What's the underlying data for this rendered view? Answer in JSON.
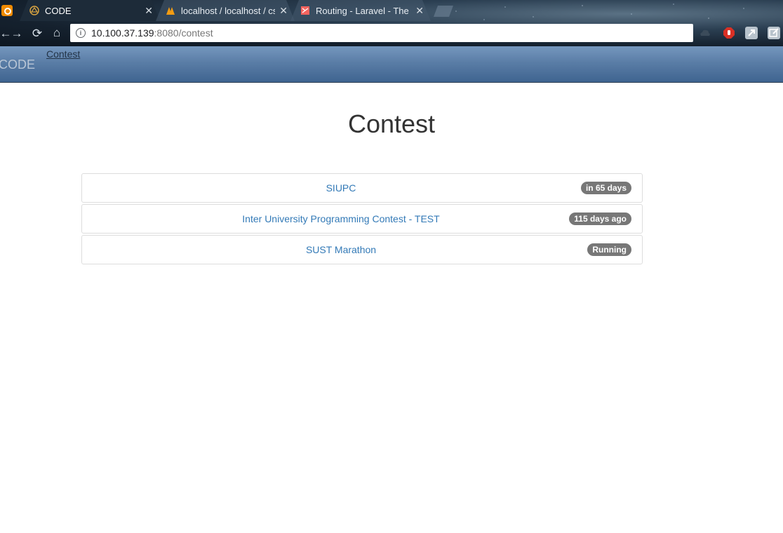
{
  "browser": {
    "tabs": [
      {
        "title": "CODE",
        "active": true
      },
      {
        "title": "localhost / localhost / cs",
        "active": false
      },
      {
        "title": "Routing - Laravel - The f",
        "active": false
      }
    ],
    "url_host": "10.100.37.139",
    "url_rest": ":8080/contest",
    "colors": {
      "frame": "#15212e",
      "omnibox": "#ffffff"
    }
  },
  "navbar": {
    "brand": "CODE",
    "links": [
      "Contest"
    ],
    "colors": {
      "gradient_top": "#7597be",
      "gradient_bottom": "#3f6490"
    }
  },
  "main": {
    "title": "Contest",
    "contests": [
      {
        "name": "SIUPC",
        "status": "in 65 days"
      },
      {
        "name": "Inter University Programming Contest - TEST",
        "status": "115 days ago"
      },
      {
        "name": "SUST Marathon",
        "status": "Running"
      }
    ],
    "colors": {
      "link": "#337ab7",
      "badge": "#777777"
    }
  }
}
